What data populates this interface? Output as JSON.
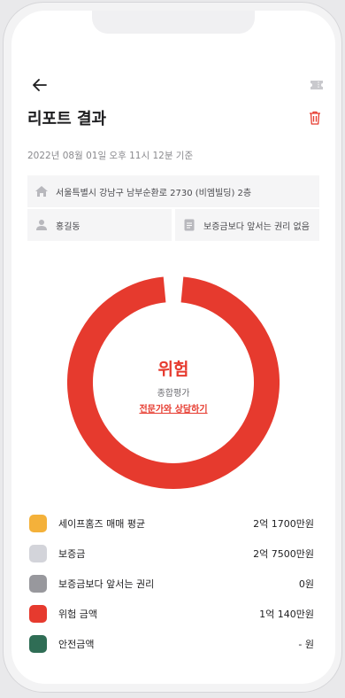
{
  "header": {
    "title": "리포트 결과",
    "timestamp": "2022년 08월 01일 오후 11시 12분 기준"
  },
  "info": {
    "address": "서울특별시 강남구 남부순환로 2730 (비엠빌딩) 2층",
    "name": "홍길동",
    "rights": "보증금보다 앞서는 권리 없음"
  },
  "result": {
    "status": "위험",
    "overall_label": "종합평가",
    "consult_link": "전문가와 상담하기",
    "risk_fraction": 0.97,
    "color": "#e63a2e"
  },
  "legend": [
    {
      "label": "세이프홈즈 매매 평균",
      "value": "2억 1700만원",
      "color": "#f4b13a"
    },
    {
      "label": "보증금",
      "value": "2억 7500만원",
      "color": "#d3d4da"
    },
    {
      "label": "보증금보다 앞서는 권리",
      "value": "0원",
      "color": "#98989d"
    },
    {
      "label": "위험 금액",
      "value": "1억 140만원",
      "color": "#e63a2e"
    },
    {
      "label": "안전금액",
      "value": "- 원",
      "color": "#2f6d55"
    }
  ],
  "icons": [
    "back-arrow-icon",
    "ticket-icon",
    "trash-icon",
    "home-icon",
    "person-icon",
    "document-icon"
  ]
}
